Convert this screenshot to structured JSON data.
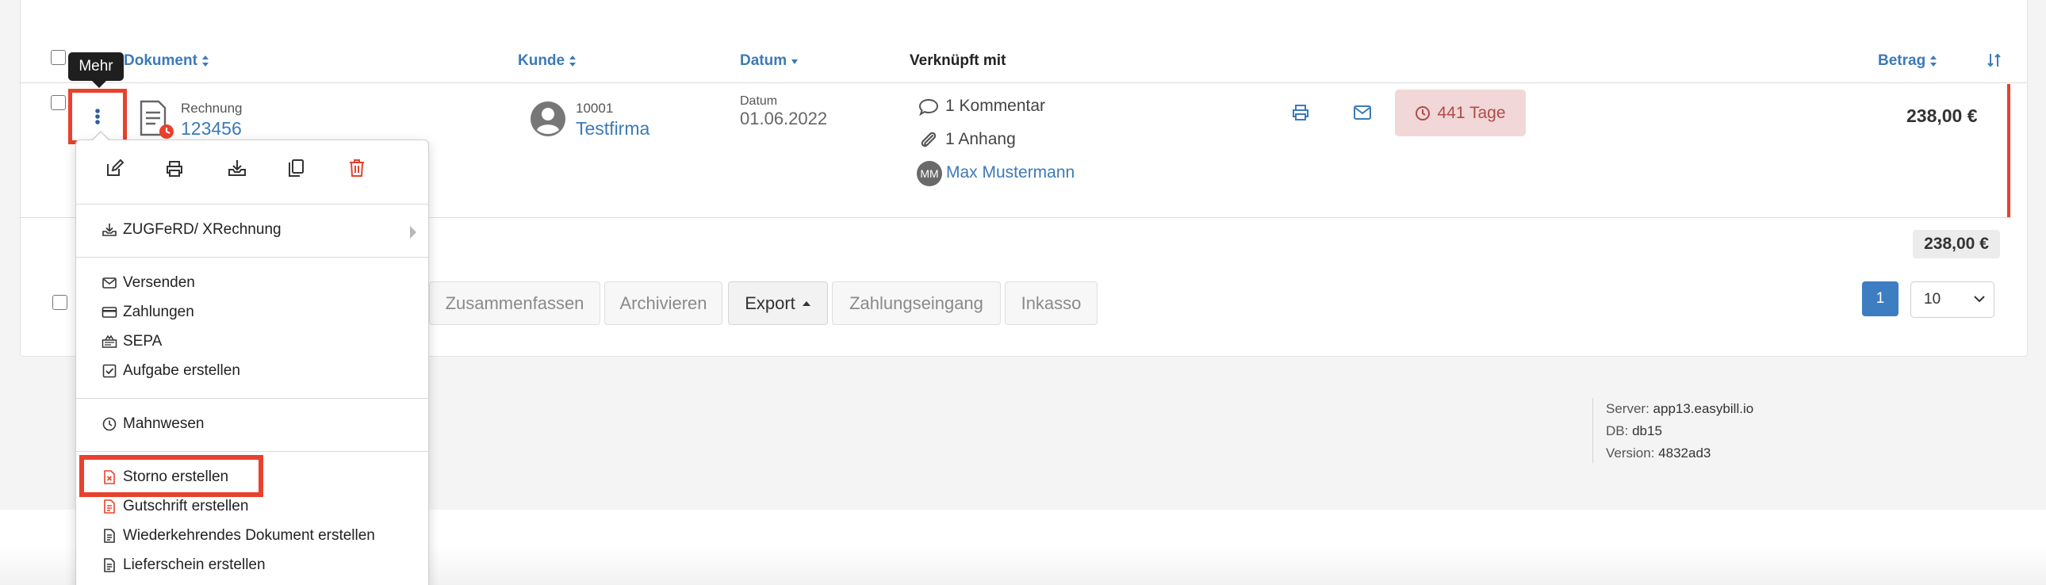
{
  "table": {
    "headers": {
      "document": "Dokument",
      "customer": "Kunde",
      "date": "Datum",
      "linked": "Verknüpft mit",
      "amount": "Betrag"
    }
  },
  "tooltip": {
    "text": "Mehr"
  },
  "row": {
    "doc_type": "Rechnung",
    "doc_number": "123456",
    "customer_number": "10001",
    "customer_name": "Testfirma",
    "date_label": "Datum",
    "date_value": "01.06.2022",
    "comments": "1 Kommentar",
    "attachments": "1 Anhang",
    "assignee_initials": "MM",
    "assignee_name": "Max Mustermann",
    "days_badge": "441 Tage",
    "amount": "238,00 €"
  },
  "totals": {
    "sum": "238,00 €"
  },
  "bulk_actions": {
    "merge": "Zusammenfassen",
    "archive": "Archivieren",
    "export": "Export",
    "payment_in": "Zahlungseingang",
    "collection": "Inkasso"
  },
  "pagination": {
    "current_page": "1",
    "per_page": "10"
  },
  "server": {
    "server_label": "Server:",
    "server_value": "app13.easybill.io",
    "db_label": "DB:",
    "db_value": "db15",
    "version_label": "Version:",
    "version_value": "4832ad3"
  },
  "menu": {
    "zugferd": "ZUGFeRD/ XRechnung",
    "send": "Versenden",
    "payments": "Zahlungen",
    "sepa": "SEPA",
    "create_task": "Aufgabe erstellen",
    "dunning": "Mahnwesen",
    "create_cancellation": "Storno erstellen",
    "create_credit_note": "Gutschrift erstellen",
    "create_recurring": "Wiederkehrendes Dokument erstellen",
    "create_delivery_note": "Lieferschein erstellen"
  },
  "colors": {
    "link": "#3c7ab8",
    "highlight": "#e8412d",
    "badge_bg": "#f1d7d7",
    "badge_text": "#b04a4a",
    "primary": "#3d7dc1"
  }
}
